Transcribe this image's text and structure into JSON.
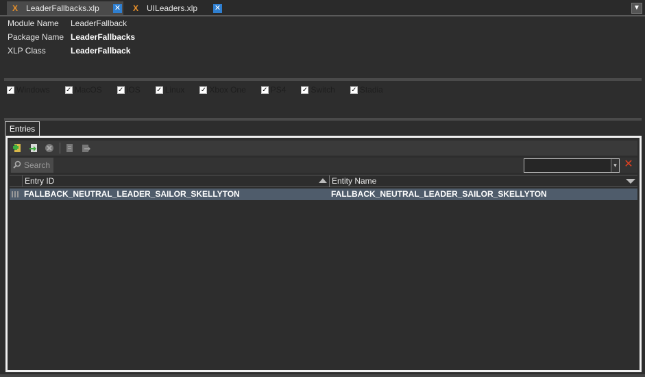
{
  "tabs": [
    {
      "icon": "X",
      "label": "LeaderFallbacks.xlp",
      "close": "✕"
    },
    {
      "icon": "X",
      "label": "UILeaders.xlp",
      "close": "✕"
    }
  ],
  "menu_button": "▼",
  "properties": [
    {
      "label": "Module Name",
      "value": "LeaderFallback"
    },
    {
      "label": "Package Name",
      "value": "LeaderFallbacks"
    },
    {
      "label": "XLP Class",
      "value": "LeaderFallback"
    }
  ],
  "platforms": [
    {
      "label": "Windows",
      "checked": "✓"
    },
    {
      "label": "MacOS",
      "checked": "✓"
    },
    {
      "label": "iOS",
      "checked": "✓"
    },
    {
      "label": "Linux",
      "checked": "✓"
    },
    {
      "label": "Xbox One",
      "checked": "✓"
    },
    {
      "label": "PS4",
      "checked": "✓"
    },
    {
      "label": "Switch",
      "checked": "✓"
    },
    {
      "label": "Stadia",
      "checked": "✓"
    }
  ],
  "entries_tab": "Entries",
  "search": {
    "placeholder": "Search",
    "icon": "search-icon"
  },
  "filter": {
    "value": "",
    "arrow": "▾",
    "clear": "✕"
  },
  "table": {
    "columns": [
      "Entry ID",
      "Entity Name"
    ],
    "rows": [
      {
        "entry_id": "FALLBACK_NEUTRAL_LEADER_SAILOR_SKELLYTON",
        "entity_name": "FALLBACK_NEUTRAL_LEADER_SAILOR_SKELLYTON"
      }
    ]
  },
  "colors": {
    "background": "#2d2d2d",
    "selected_row": "#4f5c6b",
    "tab_close": "#2f7fd0",
    "xlp_icon": "#e8902a",
    "clear_filter": "#e04020"
  }
}
